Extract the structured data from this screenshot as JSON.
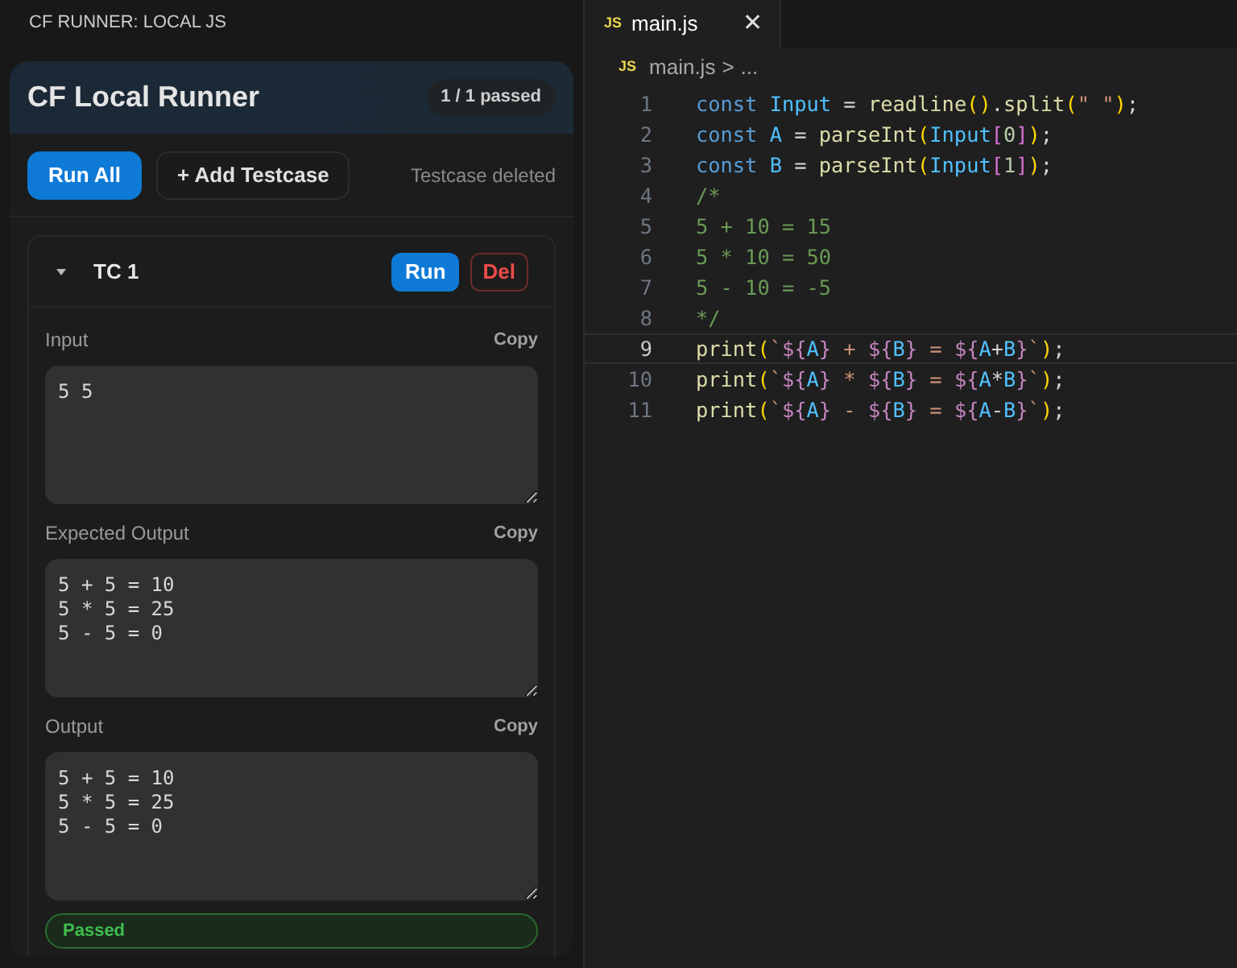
{
  "sidebar": {
    "title": "CF RUNNER: LOCAL JS"
  },
  "runner": {
    "title": "CF Local Runner",
    "summary": "1 / 1 passed",
    "buttons": [
      {
        "label": "Run All",
        "kind": "primary"
      },
      {
        "label": "+ Add Testcase",
        "kind": "secondary"
      }
    ],
    "status_message": "Testcase deleted",
    "testcases": [
      {
        "label": "TC 1",
        "expanded": true,
        "buttons": [
          {
            "label": "Run",
            "kind": "run"
          },
          {
            "label": "Del",
            "kind": "delete"
          }
        ],
        "fields": [
          {
            "label": "Input",
            "copy_label": "Copy",
            "value": "5 5"
          },
          {
            "label": "Expected Output",
            "copy_label": "Copy",
            "value": "5 + 5 = 10\n5 * 5 = 25\n5 - 5 = 0"
          },
          {
            "label": "Output",
            "copy_label": "Copy",
            "value": "5 + 5 = 10\n5 * 5 = 25\n5 - 5 = 0"
          }
        ],
        "result": {
          "text": "Passed",
          "kind": "passed"
        }
      }
    ]
  },
  "editor": {
    "tabs": [
      {
        "badge": "JS",
        "label": "main.js",
        "selected": true,
        "close": "✕"
      }
    ],
    "breadcrumb": {
      "badge": "JS",
      "file": "main.js",
      "separator": ">",
      "more": "..."
    },
    "lines": [
      {
        "number": "1",
        "current": false,
        "tokens": [
          {
            "kind": "keyword",
            "text": "const "
          },
          {
            "kind": "variable",
            "text": "Input"
          },
          {
            "kind": "plain",
            "text": " = "
          },
          {
            "kind": "function",
            "text": "readline"
          },
          {
            "kind": "brace",
            "text": "()"
          },
          {
            "kind": "plain",
            "text": "."
          },
          {
            "kind": "function",
            "text": "split"
          },
          {
            "kind": "brace",
            "text": "("
          },
          {
            "kind": "string",
            "text": "\" \""
          },
          {
            "kind": "brace",
            "text": ")"
          },
          {
            "kind": "plain",
            "text": ";"
          }
        ]
      },
      {
        "number": "2",
        "current": false,
        "tokens": [
          {
            "kind": "keyword",
            "text": "const "
          },
          {
            "kind": "constant",
            "text": "A"
          },
          {
            "kind": "plain",
            "text": " = "
          },
          {
            "kind": "function",
            "text": "parseInt"
          },
          {
            "kind": "brace",
            "text": "("
          },
          {
            "kind": "variable",
            "text": "Input"
          },
          {
            "kind": "bracket",
            "text": "["
          },
          {
            "kind": "number",
            "text": "0"
          },
          {
            "kind": "bracket",
            "text": "]"
          },
          {
            "kind": "brace",
            "text": ")"
          },
          {
            "kind": "plain",
            "text": ";"
          }
        ]
      },
      {
        "number": "3",
        "current": false,
        "tokens": [
          {
            "kind": "keyword",
            "text": "const "
          },
          {
            "kind": "constant",
            "text": "B"
          },
          {
            "kind": "plain",
            "text": " = "
          },
          {
            "kind": "function",
            "text": "parseInt"
          },
          {
            "kind": "brace",
            "text": "("
          },
          {
            "kind": "variable",
            "text": "Input"
          },
          {
            "kind": "bracket",
            "text": "["
          },
          {
            "kind": "number",
            "text": "1"
          },
          {
            "kind": "bracket",
            "text": "]"
          },
          {
            "kind": "brace",
            "text": ")"
          },
          {
            "kind": "plain",
            "text": ";"
          }
        ]
      },
      {
        "number": "4",
        "current": false,
        "tokens": [
          {
            "kind": "comment",
            "text": "/*"
          }
        ]
      },
      {
        "number": "5",
        "current": false,
        "tokens": [
          {
            "kind": "comment",
            "text": "5 + 10 = 15"
          }
        ]
      },
      {
        "number": "6",
        "current": false,
        "tokens": [
          {
            "kind": "comment",
            "text": "5 * 10 = 50"
          }
        ]
      },
      {
        "number": "7",
        "current": false,
        "tokens": [
          {
            "kind": "comment",
            "text": "5 - 10 = -5"
          }
        ]
      },
      {
        "number": "8",
        "current": false,
        "tokens": [
          {
            "kind": "comment",
            "text": "*/"
          }
        ]
      },
      {
        "number": "9",
        "current": true,
        "tokens": [
          {
            "kind": "function",
            "text": "print"
          },
          {
            "kind": "brace",
            "text": "("
          },
          {
            "kind": "string",
            "text": "`"
          },
          {
            "kind": "interp",
            "text": "${"
          },
          {
            "kind": "constant",
            "text": "A"
          },
          {
            "kind": "interp",
            "text": "}"
          },
          {
            "kind": "string",
            "text": " + "
          },
          {
            "kind": "interp",
            "text": "${"
          },
          {
            "kind": "constant",
            "text": "B"
          },
          {
            "kind": "interp",
            "text": "}"
          },
          {
            "kind": "string",
            "text": " = "
          },
          {
            "kind": "interp",
            "text": "${"
          },
          {
            "kind": "constant",
            "text": "A"
          },
          {
            "kind": "plain",
            "text": "+"
          },
          {
            "kind": "constant",
            "text": "B"
          },
          {
            "kind": "interp",
            "text": "}"
          },
          {
            "kind": "string",
            "text": "`"
          },
          {
            "kind": "brace",
            "text": ")"
          },
          {
            "kind": "plain",
            "text": ";"
          }
        ]
      },
      {
        "number": "10",
        "current": false,
        "tokens": [
          {
            "kind": "function",
            "text": "print"
          },
          {
            "kind": "brace",
            "text": "("
          },
          {
            "kind": "string",
            "text": "`"
          },
          {
            "kind": "interp",
            "text": "${"
          },
          {
            "kind": "constant",
            "text": "A"
          },
          {
            "kind": "interp",
            "text": "}"
          },
          {
            "kind": "string",
            "text": " * "
          },
          {
            "kind": "interp",
            "text": "${"
          },
          {
            "kind": "constant",
            "text": "B"
          },
          {
            "kind": "interp",
            "text": "}"
          },
          {
            "kind": "string",
            "text": " = "
          },
          {
            "kind": "interp",
            "text": "${"
          },
          {
            "kind": "constant",
            "text": "A"
          },
          {
            "kind": "plain",
            "text": "*"
          },
          {
            "kind": "constant",
            "text": "B"
          },
          {
            "kind": "interp",
            "text": "}"
          },
          {
            "kind": "string",
            "text": "`"
          },
          {
            "kind": "brace",
            "text": ")"
          },
          {
            "kind": "plain",
            "text": ";"
          }
        ]
      },
      {
        "number": "11",
        "current": false,
        "tokens": [
          {
            "kind": "function",
            "text": "print"
          },
          {
            "kind": "brace",
            "text": "("
          },
          {
            "kind": "string",
            "text": "`"
          },
          {
            "kind": "interp",
            "text": "${"
          },
          {
            "kind": "constant",
            "text": "A"
          },
          {
            "kind": "interp",
            "text": "}"
          },
          {
            "kind": "string",
            "text": " - "
          },
          {
            "kind": "interp",
            "text": "${"
          },
          {
            "kind": "constant",
            "text": "B"
          },
          {
            "kind": "interp",
            "text": "}"
          },
          {
            "kind": "string",
            "text": " = "
          },
          {
            "kind": "interp",
            "text": "${"
          },
          {
            "kind": "constant",
            "text": "A"
          },
          {
            "kind": "plain",
            "text": "-"
          },
          {
            "kind": "constant",
            "text": "B"
          },
          {
            "kind": "interp",
            "text": "}"
          },
          {
            "kind": "string",
            "text": "`"
          },
          {
            "kind": "brace",
            "text": ")"
          },
          {
            "kind": "plain",
            "text": ";"
          }
        ]
      }
    ]
  }
}
